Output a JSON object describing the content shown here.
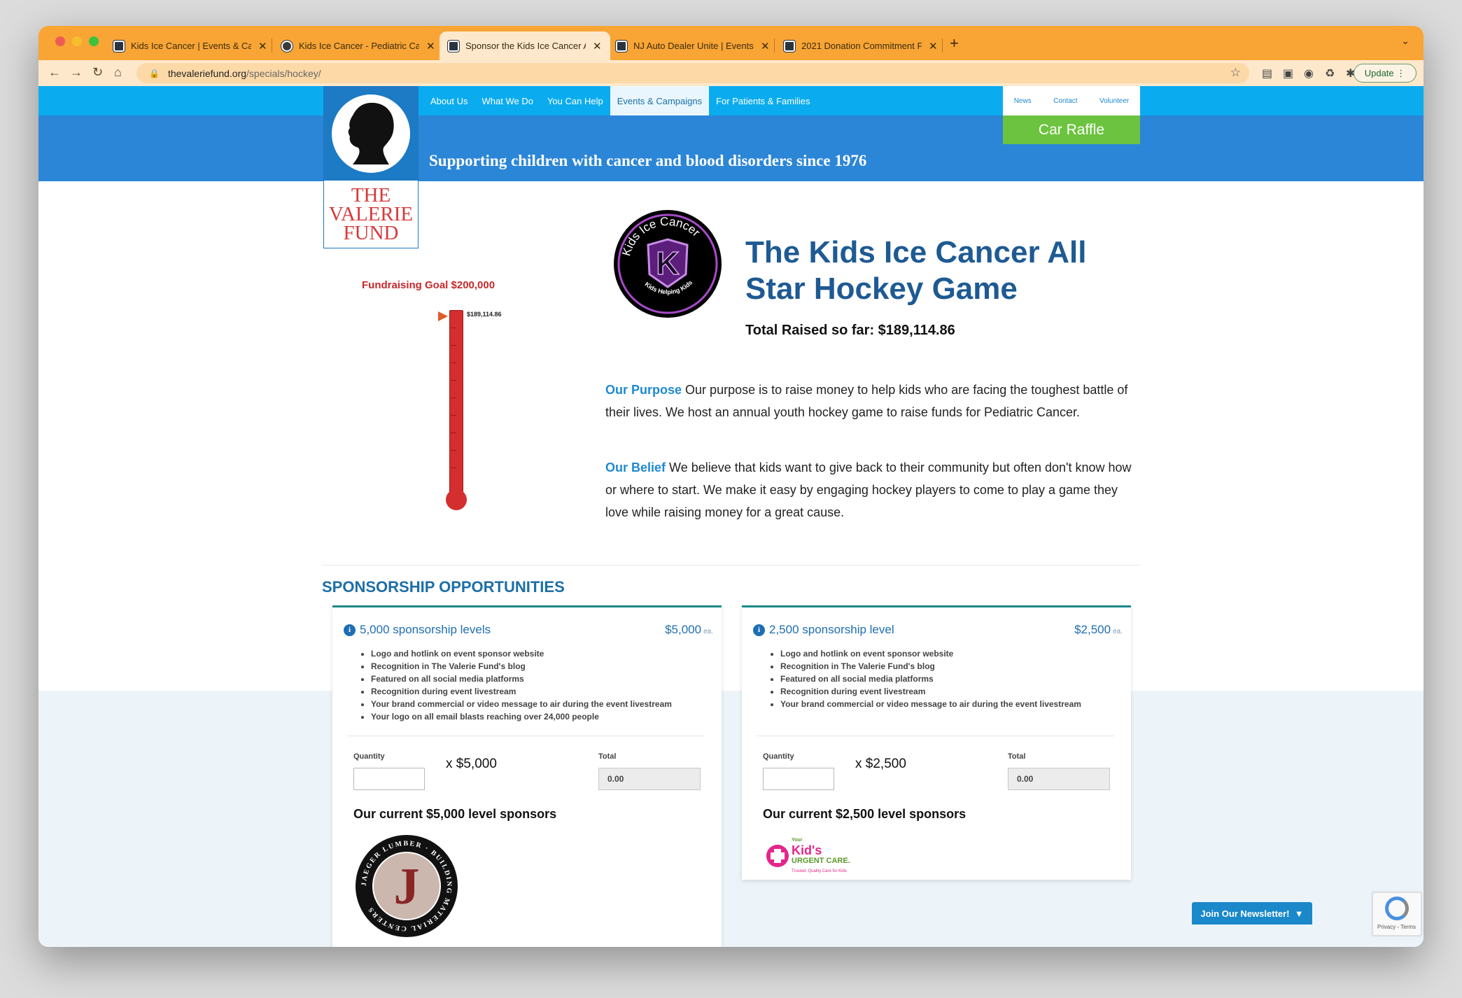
{
  "browser": {
    "tabs": [
      {
        "title": "Kids Ice Cancer | Events & Cam",
        "active": false
      },
      {
        "title": "Kids Ice Cancer - Pediatric Ca",
        "active": false
      },
      {
        "title": "Sponsor the Kids Ice Cancer Al",
        "active": true
      },
      {
        "title": "NJ Auto Dealer Unite | Events &",
        "active": false
      },
      {
        "title": "2021 Donation Commitment Fo",
        "active": false
      }
    ],
    "url_host": "thevaleriefund.org",
    "url_path": "/specials/hockey/",
    "update_label": "Update"
  },
  "site": {
    "logo_text": [
      "THE",
      "VALERIE",
      "FUND"
    ],
    "menu": [
      "About Us",
      "What We Do",
      "You Can Help",
      "Events & Campaigns",
      "For Patients & Families"
    ],
    "active_menu": "Events & Campaigns",
    "toplinks": [
      "News",
      "Contact",
      "Volunteer"
    ],
    "car_raffle": "Car Raffle",
    "tagline": "Supporting children with cancer and blood disorders since 1976"
  },
  "fundraiser": {
    "goal_label": "Fundraising Goal $200,000",
    "raised_marker": "$189,114.86",
    "progress_fraction": 0.9456,
    "badge_top_text": "Kids Ice Cancer",
    "badge_bottom_text": "Kids Helping Kids",
    "badge_letter": "K",
    "title": "The Kids Ice Cancer All Star Hockey Game",
    "raised_label": "Total Raised so far: $189,114.86",
    "purpose_lead": "Our Purpose",
    "purpose_text": "Our purpose is to raise money to help kids who are facing the toughest battle of their lives. We host an annual youth hockey game to raise funds for Pediatric Cancer.",
    "belief_lead": "Our Belief",
    "belief_text": "We believe that kids want to give back to their community but often don't know how or where to start. We make it easy by engaging hockey players to come to play a game they love while raising money for a great cause."
  },
  "sponsorship": {
    "section_title": "SPONSORSHIP OPPORTUNITIES",
    "cards": [
      {
        "title": "5,000 sponsorship levels",
        "price": "$5,000",
        "price_unit": "ea.",
        "benefits": [
          "Logo and hotlink on event sponsor website",
          "Recognition in The Valerie Fund's blog",
          "Featured on all social media platforms",
          "Recognition during event livestream",
          "Your brand commercial or video message to air during the event livestream",
          "Your logo on all email blasts reaching over 24,000 people"
        ],
        "quantity_label": "Quantity",
        "multiplier": "x $5,000",
        "total_label": "Total",
        "total_value": "0.00",
        "current_label": "Our current $5,000 level sponsors",
        "sponsor_logo": {
          "ring_text": "JAEGER LUMBER · BUILDING MATERIAL CENTERS",
          "letter": "J"
        }
      },
      {
        "title": "2,500 sponsorship level",
        "price": "$2,500",
        "price_unit": "ea.",
        "benefits": [
          "Logo and hotlink on event sponsor website",
          "Recognition in The Valerie Fund's blog",
          "Featured on all social media platforms",
          "Recognition during event livestream",
          "Your brand commercial or video message to air during the event livestream"
        ],
        "quantity_label": "Quantity",
        "multiplier": "x $2,500",
        "total_label": "Total",
        "total_value": "0.00",
        "current_label": "Our current $2,500 level sponsors",
        "sponsor_logo": {
          "top_text": "Your",
          "name": "Kid's",
          "subtitle": "URGENT CARE.",
          "tagline": "Trusted, Quality Care for Kids"
        }
      }
    ]
  },
  "widgets": {
    "newsletter": "Join Our Newsletter!",
    "newsletter_arrow": "▼",
    "recaptcha_text": "Privacy - Terms"
  },
  "colors": {
    "tabstrip": "#f8a535",
    "nav_band": "#0bacef",
    "header_band": "#2b86d7",
    "car_raffle": "#6cc33f",
    "thermometer": "#d42e2e",
    "title_blue": "#1e5a93"
  }
}
